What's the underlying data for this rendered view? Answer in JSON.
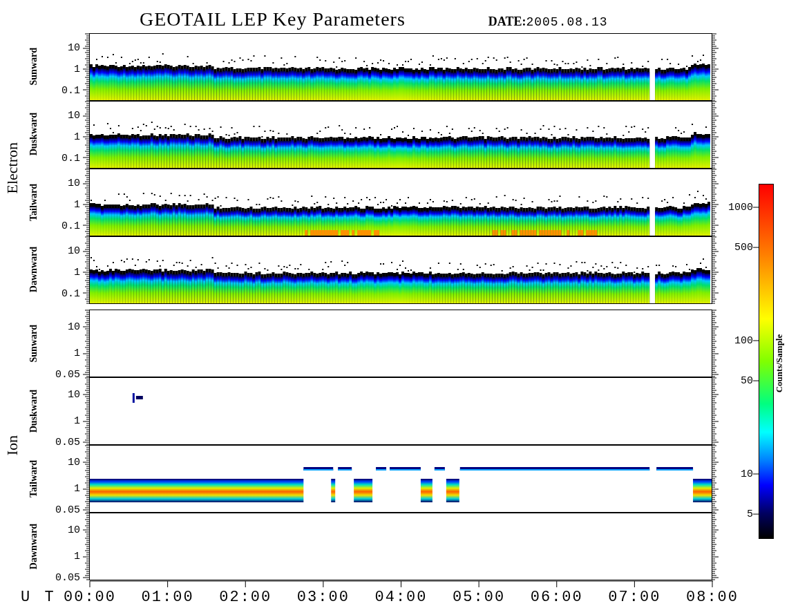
{
  "title": "GEOTAIL LEP Key Parameters",
  "date_label": "DATE:",
  "date": "2005.08.13",
  "groups": [
    {
      "name": "Electron",
      "panels": [
        {
          "direction": "Sunward",
          "yticks": [
            "10",
            "1",
            "0.1"
          ]
        },
        {
          "direction": "Duskward",
          "yticks": [
            "10",
            "1",
            "0.1"
          ]
        },
        {
          "direction": "Tailward",
          "yticks": [
            "10",
            "1",
            "0.1"
          ]
        },
        {
          "direction": "Dawnward",
          "yticks": [
            "10",
            "1",
            "0.1"
          ]
        }
      ]
    },
    {
      "name": "Ion",
      "panels": [
        {
          "direction": "Sunward",
          "yticks": [
            "10",
            "1",
            "0.05"
          ]
        },
        {
          "direction": "Duskward",
          "yticks": [
            "10",
            "1",
            "0.05"
          ]
        },
        {
          "direction": "Tailward",
          "yticks": [
            "10",
            "1",
            "0.05"
          ]
        },
        {
          "direction": "Dawnward",
          "yticks": [
            "10",
            "1",
            "0.05"
          ]
        }
      ]
    }
  ],
  "time_axis": {
    "label": "U T",
    "ticks": [
      "00:00",
      "01:00",
      "02:00",
      "03:00",
      "04:00",
      "05:00",
      "06:00",
      "07:00",
      "08:00"
    ]
  },
  "colorbar": {
    "title": "Counts/Sample",
    "ticks": [
      "1000",
      "500",
      "100",
      "50",
      "10",
      "5"
    ]
  }
}
